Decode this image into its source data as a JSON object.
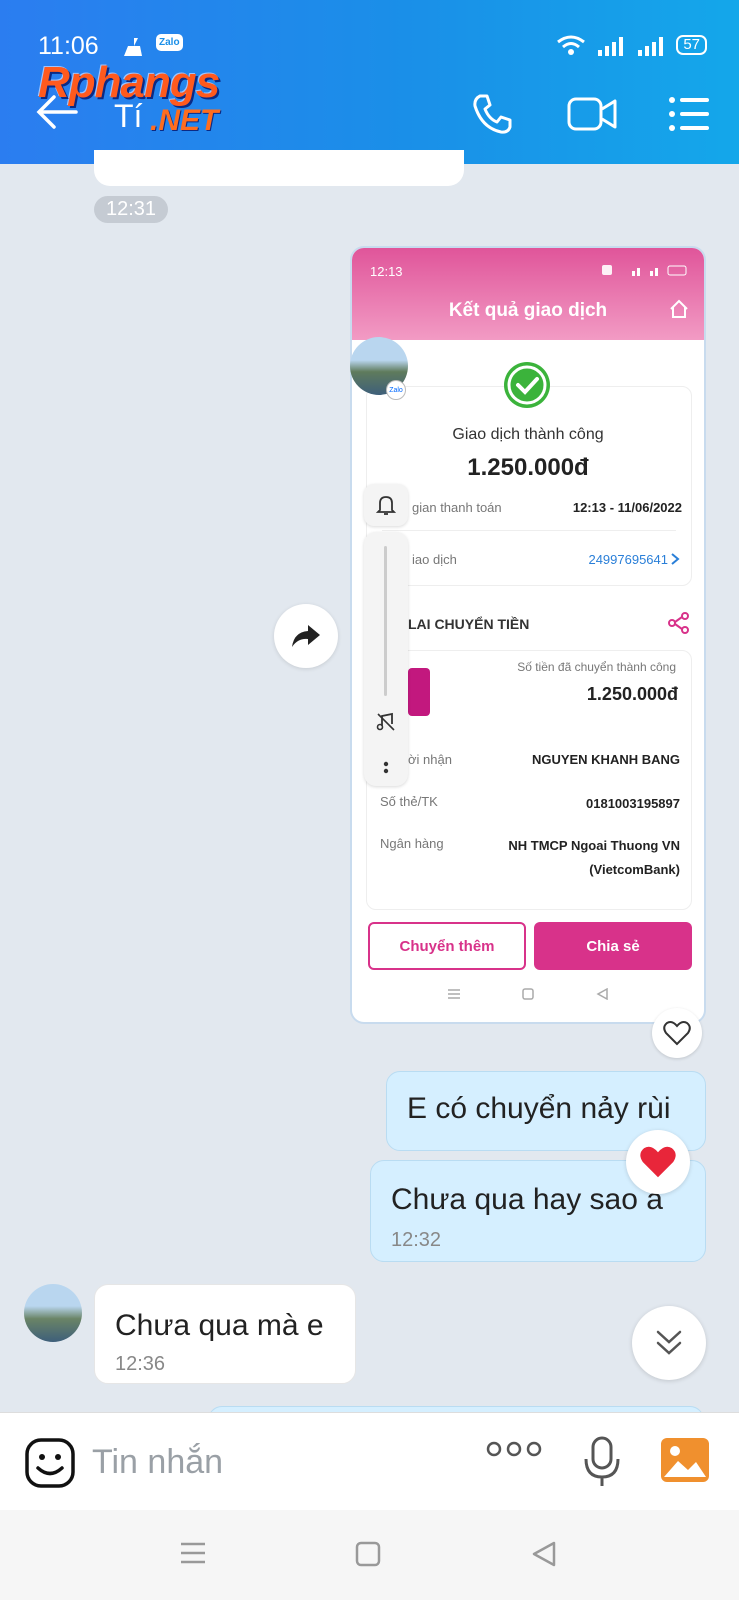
{
  "status_bar": {
    "time": "11:06",
    "battery": "57",
    "zalo_badge": "Zalo"
  },
  "header": {
    "watermark_line1": "Rphangs",
    "watermark_ti": "Tí",
    "watermark_net": ".NET",
    "icons": [
      "back-arrow-icon",
      "phone-icon",
      "video-call-icon",
      "menu-list-icon"
    ]
  },
  "chat": {
    "prev_timestamp": "12:31",
    "screenshot": {
      "status_time": "12:13",
      "title": "Kết quả giao dịch",
      "status_text": "Giao dịch thành công",
      "amount": "1.250.000đ",
      "time_label": "gian thanh toán",
      "time_value": "12:13 - 11/06/2022",
      "txn_label": "iao dịch",
      "txn_value": "24997695641",
      "section_title": "LAI CHUYỂN TIỀN",
      "transferred_label": "Số tiền đã chuyển thành công",
      "transferred_amount": "1.250.000đ",
      "recipient_label": "ời nhận",
      "recipient_value": "NGUYEN KHANH BANG",
      "card_label": "Số thẻ/TK",
      "card_value": "0181003195897",
      "bank_label": "Ngân hàng",
      "bank_value_1": "NH TMCP Ngoai Thuong VN",
      "bank_value_2": "(VietcomBank)",
      "btn_more": "Chuyển thêm",
      "btn_share": "Chia sẻ"
    },
    "messages": [
      {
        "text": "E có chuyển nảy rùi"
      },
      {
        "text": "Chưa qua hay sao a",
        "time": "12:32"
      },
      {
        "text": "Chưa qua mà e",
        "time": "12:36"
      }
    ],
    "reaction": "heart"
  },
  "input": {
    "placeholder": "Tin nhắn",
    "value": ""
  },
  "colors": {
    "header": "#1a8fe8",
    "my_bubble": "#d5efff",
    "accent_pink": "#d8328a"
  }
}
